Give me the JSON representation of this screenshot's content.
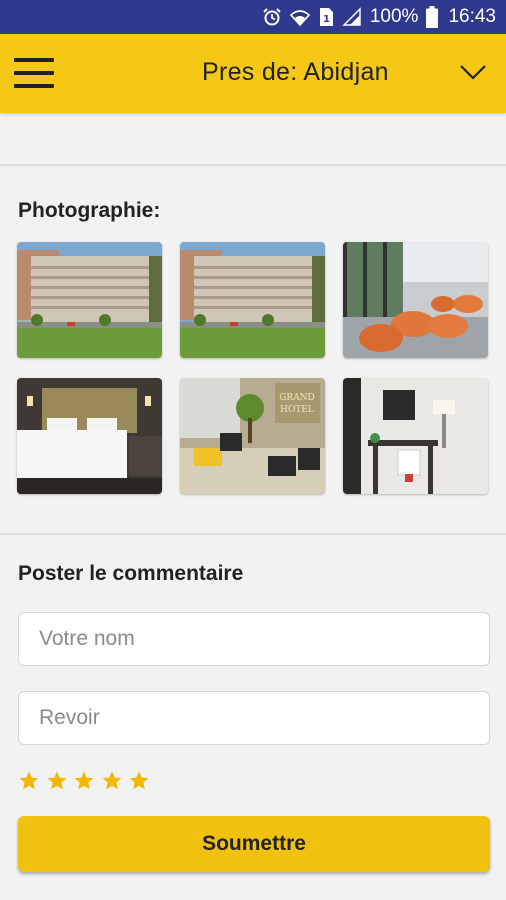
{
  "status_bar": {
    "battery_percent": "100%",
    "time": "16:43",
    "icons": [
      "alarm-icon",
      "wifi-icon",
      "sim-icon",
      "signal-icon",
      "battery-icon"
    ]
  },
  "header": {
    "title": "Pres de: Abidjan",
    "menu_icon": "hamburger-menu-icon",
    "dropdown_icon": "chevron-down-icon"
  },
  "gallery": {
    "heading": "Photographie:",
    "photos": [
      {
        "subject": "hotel-exterior"
      },
      {
        "subject": "hotel-exterior"
      },
      {
        "subject": "lounge-orange-chairs"
      },
      {
        "subject": "bedroom"
      },
      {
        "subject": "lobby"
      },
      {
        "subject": "room-desk"
      }
    ]
  },
  "comment_form": {
    "heading": "Poster le commentaire",
    "name_placeholder": "Votre nom",
    "review_placeholder": "Revoir",
    "rating": 5,
    "rating_max": 5,
    "submit_label": "Soumettre"
  },
  "colors": {
    "status_bar": "#2f3a8f",
    "header": "#f5c816",
    "button": "#f0c20f",
    "star": "#f2b705"
  }
}
